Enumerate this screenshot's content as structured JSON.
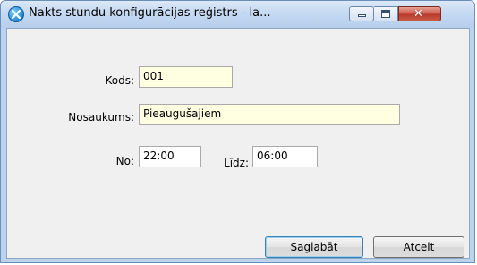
{
  "window": {
    "title": "Nakts stundu konfigurācijas reģistrs - la...",
    "icon": "app-globe-icon"
  },
  "title_buttons": {
    "minimize_icon": "minimize-icon",
    "maximize_icon": "maximize-icon",
    "close_icon": "close-icon",
    "close_glyph": "✕"
  },
  "form": {
    "code_label": "Kods:",
    "code_value": "001",
    "name_label": "Nosaukums:",
    "name_value": "Pieaugušajiem",
    "from_label": "No:",
    "from_value": "22:00",
    "to_label": "Līdz:",
    "to_value": "06:00"
  },
  "buttons": {
    "save_label": "Saglabāt",
    "cancel_label": "Atcelt"
  },
  "colors": {
    "required_field_bg": "#ffffe1",
    "close_button": "#c75b47",
    "titlebar": "#c5d9f1"
  }
}
